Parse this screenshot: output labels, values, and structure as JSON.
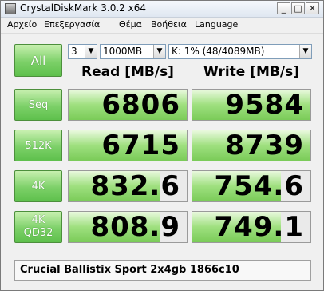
{
  "window": {
    "title": "CrystalDiskMark 3.0.2 x64",
    "controls": [
      "minimize",
      "maximize",
      "close"
    ]
  },
  "menu": [
    "Αρχείο",
    "Επεξεργασία",
    "Θέμα",
    "Βοήθεια",
    "Language"
  ],
  "controls": {
    "all_label": "All",
    "runs": "3",
    "size": "1000MB",
    "drive": "K: 1% (48/4089MB)"
  },
  "columns": {
    "read": "Read [MB/s]",
    "write": "Write [MB/s]"
  },
  "rows": [
    {
      "label": "Seq",
      "read": "6806",
      "write": "9584",
      "read_fill": 1.0,
      "write_fill": 1.0
    },
    {
      "label": "512K",
      "read": "6715",
      "write": "8739",
      "read_fill": 1.0,
      "write_fill": 1.0
    },
    {
      "label": "4K",
      "read": "832.6",
      "write": "754.6",
      "read_fill": 0.78,
      "write_fill": 0.75
    },
    {
      "label_line1": "4K",
      "label_line2": "QD32",
      "read": "808.9",
      "write": "749.1",
      "read_fill": 0.77,
      "write_fill": 0.75
    }
  ],
  "comment": "Crucial Ballistix Sport 2x4gb 1866c10"
}
